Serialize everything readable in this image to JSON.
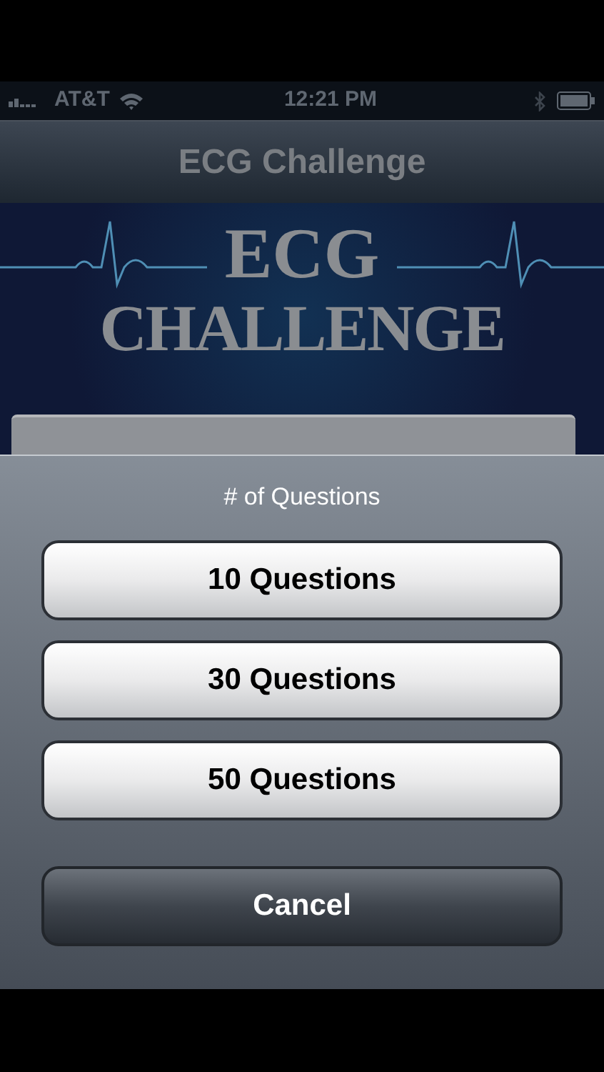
{
  "status_bar": {
    "carrier": "AT&T",
    "time": "12:21 PM"
  },
  "nav_bar": {
    "title": "ECG Challenge"
  },
  "banner": {
    "title_line_1": "ECG",
    "title_line_2": "CHALLENGE"
  },
  "action_sheet": {
    "title": "# of Questions",
    "options": [
      {
        "label": "10 Questions"
      },
      {
        "label": "30 Questions"
      },
      {
        "label": "50 Questions"
      }
    ],
    "cancel": "Cancel"
  }
}
